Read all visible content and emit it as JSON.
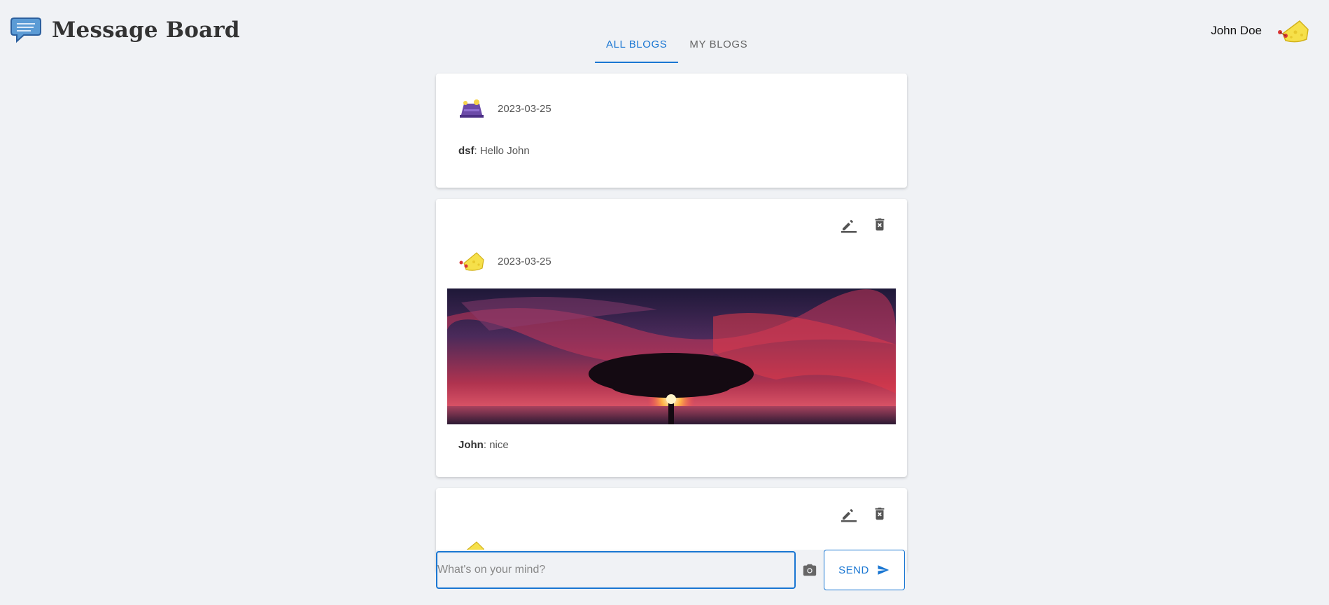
{
  "app": {
    "title": "Message Board"
  },
  "tabs": [
    {
      "label": "ALL BLOGS",
      "active": true
    },
    {
      "label": "MY BLOGS",
      "active": false
    }
  ],
  "user": {
    "name": "John Doe",
    "avatar_icon": "yellow-cheese-avatar-icon"
  },
  "posts": [
    {
      "avatar_icon": "purple-hat-avatar-icon",
      "date": "2023-03-25",
      "author": "dsf",
      "separator": ": ",
      "text": "Hello John",
      "editable": false
    },
    {
      "avatar_icon": "yellow-cheese-avatar-icon",
      "date": "2023-03-25",
      "author": "John",
      "separator": ": ",
      "text": "nice",
      "editable": true,
      "image_icon": "sunset-tree-image"
    },
    {
      "avatar_icon": "yellow-cheese-avatar-icon",
      "editable": true
    }
  ],
  "compose": {
    "placeholder": "What's on your mind?",
    "send_label": "SEND"
  },
  "colors": {
    "accent": "#1976d2",
    "background": "#f0f2f5"
  }
}
